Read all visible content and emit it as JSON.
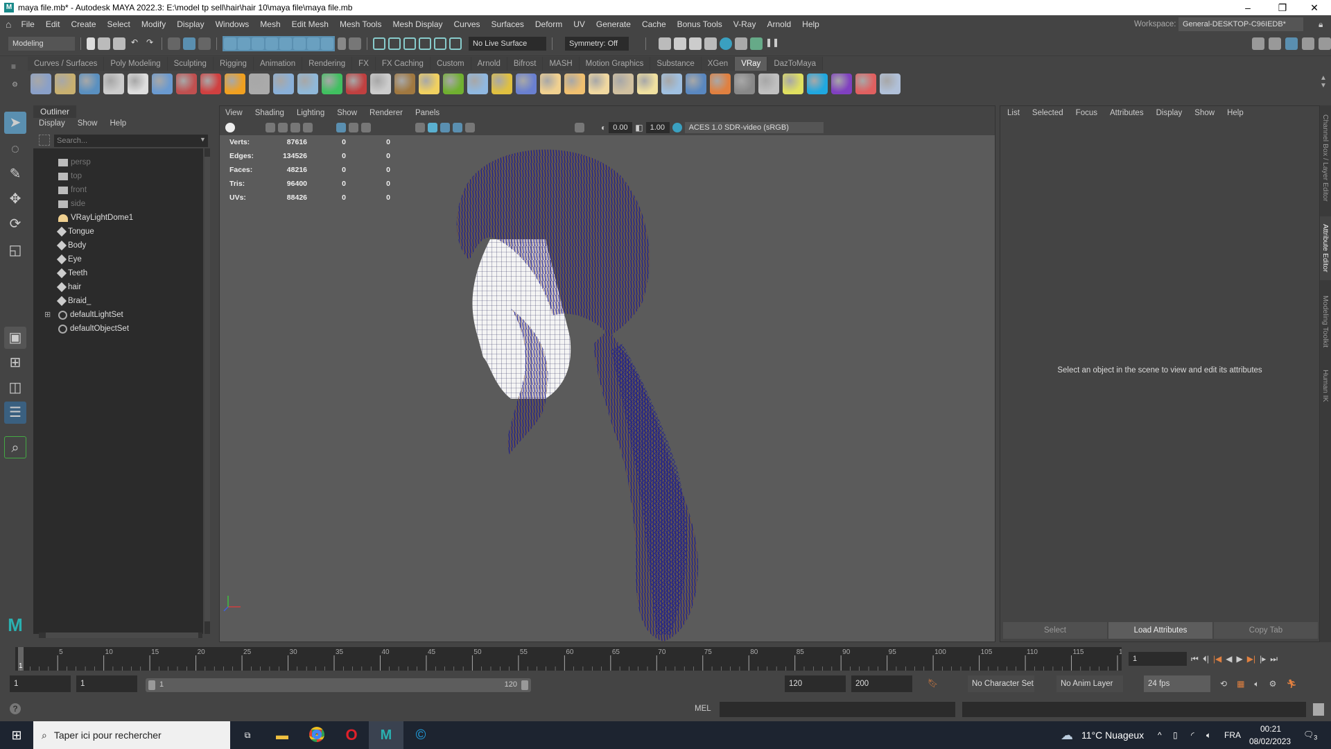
{
  "window": {
    "title": "maya file.mb* - Autodesk MAYA 2022.3: E:\\model tp sell\\hair\\hair 10\\maya file\\maya file.mb",
    "app_logo": "M",
    "minimize": "–",
    "restore": "❐",
    "close": "✕"
  },
  "menubar": {
    "items": [
      "File",
      "Edit",
      "Create",
      "Select",
      "Modify",
      "Display",
      "Windows",
      "Mesh",
      "Edit Mesh",
      "Mesh Tools",
      "Mesh Display",
      "Curves",
      "Surfaces",
      "Deform",
      "UV",
      "Generate",
      "Cache",
      "Bonus Tools",
      "V-Ray",
      "Arnold",
      "Help"
    ],
    "workspace_label": "Workspace:",
    "workspace_value": "General-DESKTOP-C96IEDB*"
  },
  "statusline": {
    "menuset": "Modeling",
    "live_surface": "No Live Surface",
    "symmetry": "Symmetry: Off"
  },
  "shelf": {
    "tabs": [
      "Curves / Surfaces",
      "Poly Modeling",
      "Sculpting",
      "Rigging",
      "Animation",
      "Rendering",
      "FX",
      "FX Caching",
      "Custom",
      "Arnold",
      "Bifrost",
      "MASH",
      "Motion Graphics",
      "Substance",
      "XGen",
      "VRay",
      "DazToMaya"
    ],
    "active_tab": "VRay",
    "icons": [
      {
        "name": "vray-export-icon",
        "color": "#8aa0c8"
      },
      {
        "name": "vray-proxy-icon",
        "color": "#c8b070"
      },
      {
        "name": "vray-scene-icon",
        "color": "#5a90c0"
      },
      {
        "name": "plug-icon",
        "color": "#cccccc"
      },
      {
        "name": "document-icon",
        "color": "#dddddd"
      },
      {
        "name": "sphere-blue-icon",
        "color": "#6a9ad0"
      },
      {
        "name": "camera-icon",
        "color": "#c05050"
      },
      {
        "name": "spheres-icon",
        "color": "#d04040"
      },
      {
        "name": "fire-icon",
        "color": "#f0a020"
      },
      {
        "name": "pyramid-icon",
        "color": "#aaaaaa"
      },
      {
        "name": "cube-light-icon",
        "color": "#8ab0d8"
      },
      {
        "name": "cone-icon",
        "color": "#90b8d8"
      },
      {
        "name": "spot-light-icon",
        "color": "#40c060"
      },
      {
        "name": "material-icon",
        "color": "#c04040"
      },
      {
        "name": "material-sphere-icon",
        "color": "#cccccc"
      },
      {
        "name": "texture-icon",
        "color": "#a07840"
      },
      {
        "name": "globe-icon",
        "color": "#f0d060"
      },
      {
        "name": "grass-icon",
        "color": "#70b030"
      },
      {
        "name": "particles-icon",
        "color": "#90b8e0"
      },
      {
        "name": "curve-icon",
        "color": "#e0c040"
      },
      {
        "name": "sphere-grid-icon",
        "color": "#6a80d0"
      },
      {
        "name": "dome-light-icon",
        "color": "#f0d090"
      },
      {
        "name": "lamp-icon",
        "color": "#f0c070"
      },
      {
        "name": "sun-icon",
        "color": "#f0d8a0"
      },
      {
        "name": "ies-light-icon",
        "color": "#d0c0a0"
      },
      {
        "name": "sunburst-icon",
        "color": "#f0e0a0"
      },
      {
        "name": "plane-icon",
        "color": "#a0c0e0"
      },
      {
        "name": "sphere-shaded-icon",
        "color": "#5a88c0"
      },
      {
        "name": "vray-color-icon",
        "color": "#e08040"
      },
      {
        "name": "checker-icon",
        "color": "#888888"
      },
      {
        "name": "frame-buffer-icon",
        "color": "#c0c0c0"
      },
      {
        "name": "bulb-icon",
        "color": "#e0e060"
      },
      {
        "name": "chaos-cloud-icon",
        "color": "#20a8e0"
      },
      {
        "name": "cosmos-icon",
        "color": "#8040c0"
      },
      {
        "name": "palette-icon",
        "color": "#e06060"
      },
      {
        "name": "help-icon",
        "color": "#b0c0d8"
      }
    ]
  },
  "toolbox": {
    "tools": [
      "select-tool-icon",
      "lasso-tool-icon",
      "paint-select-tool-icon",
      "move-tool-icon",
      "rotate-tool-icon",
      "scale-tool-icon"
    ]
  },
  "outliner": {
    "title": "Outliner",
    "menu": [
      "Display",
      "Show",
      "Help"
    ],
    "search_placeholder": "Search...",
    "items": [
      {
        "label": "persp",
        "type": "camera",
        "dim": true
      },
      {
        "label": "top",
        "type": "camera",
        "dim": true
      },
      {
        "label": "front",
        "type": "camera",
        "dim": true
      },
      {
        "label": "side",
        "type": "camera",
        "dim": true
      },
      {
        "label": "VRayLightDome1",
        "type": "light"
      },
      {
        "label": "Tongue",
        "type": "mesh"
      },
      {
        "label": "Body",
        "type": "mesh"
      },
      {
        "label": "Eye",
        "type": "mesh"
      },
      {
        "label": "Teeth",
        "type": "mesh"
      },
      {
        "label": "hair",
        "type": "mesh"
      },
      {
        "label": "Braid_",
        "type": "mesh"
      },
      {
        "label": "defaultLightSet",
        "type": "set",
        "expandable": true,
        "expand_glyph": "⊞"
      },
      {
        "label": "defaultObjectSet",
        "type": "set"
      }
    ]
  },
  "viewport": {
    "menu": [
      "View",
      "Shading",
      "Lighting",
      "Show",
      "Renderer",
      "Panels"
    ],
    "exposure": "0.00",
    "gamma": "1.00",
    "color_space": "ACES 1.0 SDR-video (sRGB)",
    "hud": [
      {
        "label": "Verts:",
        "v1": "87616",
        "v2": "0",
        "v3": "0"
      },
      {
        "label": "Edges:",
        "v1": "134526",
        "v2": "0",
        "v3": "0"
      },
      {
        "label": "Faces:",
        "v1": "48216",
        "v2": "0",
        "v3": "0"
      },
      {
        "label": "Tris:",
        "v1": "96400",
        "v2": "0",
        "v3": "0"
      },
      {
        "label": "UVs:",
        "v1": "88426",
        "v2": "0",
        "v3": "0"
      }
    ],
    "wire_color": "#1c1c8c",
    "hair_color": "#7a4a30"
  },
  "attribute_editor": {
    "menu": [
      "List",
      "Selected",
      "Focus",
      "Attributes",
      "Display",
      "Show",
      "Help"
    ],
    "message": "Select an object in the scene to view and edit its attributes",
    "buttons": [
      "Select",
      "Load Attributes",
      "Copy Tab"
    ]
  },
  "side_tabs": [
    "Channel Box / Layer Editor",
    "Attribute Editor",
    "Modeling Toolkit",
    "Human IK"
  ],
  "timeline": {
    "start": 1,
    "end": 120,
    "current": "1",
    "tick_step": 5,
    "current_frame_field": "1"
  },
  "range": {
    "start_field": "1",
    "playback_start": "1",
    "slider_start": "1",
    "slider_end": "120",
    "playback_end": "120",
    "end_field": "200",
    "character_set": "No Character Set",
    "anim_layer": "No Anim Layer",
    "fps": "24 fps"
  },
  "cmdline": {
    "lang": "MEL",
    "help_glyph": "?"
  },
  "taskbar": {
    "search_placeholder": "Taper ici pour rechercher",
    "weather": "11°C  Nuageux",
    "lang": "FRA",
    "time": "00:21",
    "date": "08/02/2023",
    "notifications": "3"
  }
}
